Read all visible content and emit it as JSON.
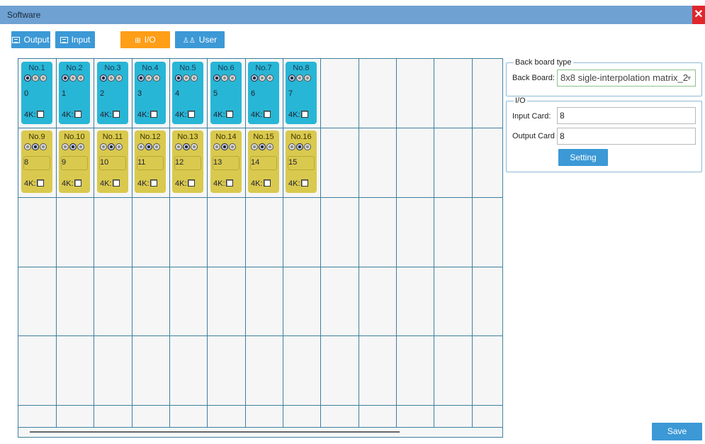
{
  "window": {
    "title": "Software",
    "close_glyph": "✕"
  },
  "tabs": [
    {
      "label": "Output",
      "icon": "grid-icon",
      "active": false
    },
    {
      "label": "Input",
      "icon": "grid-icon",
      "active": false
    },
    {
      "label": "I/O",
      "icon": "io-icon",
      "active": true
    },
    {
      "label": "User",
      "icon": "user-icon",
      "active": false
    }
  ],
  "cards": {
    "four_k_label": "4K:",
    "input": [
      {
        "label": "No.1",
        "value": "0"
      },
      {
        "label": "No.2",
        "value": "1"
      },
      {
        "label": "No.3",
        "value": "2"
      },
      {
        "label": "No.4",
        "value": "3"
      },
      {
        "label": "No.5",
        "value": "4"
      },
      {
        "label": "No.6",
        "value": "5"
      },
      {
        "label": "No.7",
        "value": "6"
      },
      {
        "label": "No.8",
        "value": "7"
      }
    ],
    "output": [
      {
        "label": "No.9",
        "value": "8"
      },
      {
        "label": "No.10",
        "value": "9"
      },
      {
        "label": "No.11",
        "value": "10"
      },
      {
        "label": "No.12",
        "value": "11"
      },
      {
        "label": "No.13",
        "value": "12"
      },
      {
        "label": "No.14",
        "value": "13"
      },
      {
        "label": "No.15",
        "value": "14"
      },
      {
        "label": "No.16",
        "value": "15"
      }
    ]
  },
  "backboard": {
    "legend": "Back board type",
    "label": "Back Board:",
    "selected": "8x8 sigle-interpolation matrix_2"
  },
  "io": {
    "legend": "I/O",
    "input_label": "Input Card:",
    "input_value": "8",
    "output_label": "Output Card",
    "output_value": "8",
    "setting_label": "Setting"
  },
  "save_label": "Save",
  "colors": {
    "tab": "#3c99d6",
    "tab_active": "#ff9e17",
    "input_card": "#28b6d6",
    "output_card": "#d9c94e",
    "titlebar": "#6fa1d3"
  }
}
